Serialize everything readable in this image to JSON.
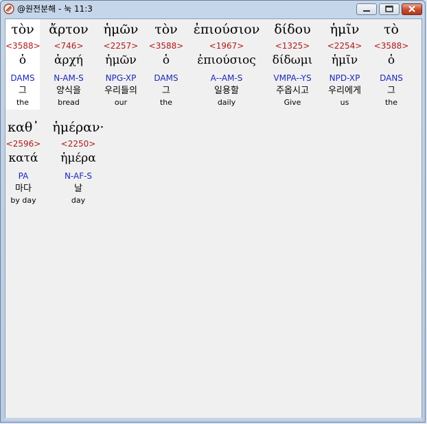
{
  "window": {
    "title": "@원전분해 - 눅 11:3",
    "min_label": "—",
    "max_label": "▢",
    "close_label": "✕"
  },
  "words": [
    {
      "greek": "τὸν",
      "strong": "<3588>",
      "lemma": "ὁ",
      "parse": "DAMS",
      "korean": "그",
      "english": "the"
    },
    {
      "greek": "ἄρτον",
      "strong": "<746>",
      "lemma": "ἀρχή",
      "parse": "N-AM-S",
      "korean": "양식을",
      "english": "bread"
    },
    {
      "greek": "ἡμῶν",
      "strong": "<2257>",
      "lemma": "ἡμῶν",
      "parse": "NPG-XP",
      "korean": "우리들의",
      "english": "our"
    },
    {
      "greek": "τὸν",
      "strong": "<3588>",
      "lemma": "ὁ",
      "parse": "DAMS",
      "korean": "그",
      "english": "the"
    },
    {
      "greek": "ἐπιούσιον",
      "strong": "<1967>",
      "lemma": "ἐπιούσιος",
      "parse": "A--AM-S",
      "korean": "일용할",
      "english": "daily"
    },
    {
      "greek": "δίδου",
      "strong": "<1325>",
      "lemma": "δίδωμι",
      "parse": "VMPA--YS",
      "korean": "주옵시고",
      "english": "Give"
    },
    {
      "greek": "ἡμῖν",
      "strong": "<2254>",
      "lemma": "ἡμῖν",
      "parse": "NPD-XP",
      "korean": "우리에게",
      "english": "us"
    },
    {
      "greek": "τὸ",
      "strong": "<3588>",
      "lemma": "ὁ",
      "parse": "DANS",
      "korean": "그",
      "english": "the"
    },
    {
      "greek": "καθ᾽",
      "strong": "<2596>",
      "lemma": "κατά",
      "parse": "PA",
      "korean": "마다",
      "english": "by day"
    },
    {
      "greek": "ἡμέραν·",
      "strong": "<2250>",
      "lemma": "ἡμέρα",
      "parse": "N-AF-S",
      "korean": "날",
      "english": "day"
    }
  ]
}
